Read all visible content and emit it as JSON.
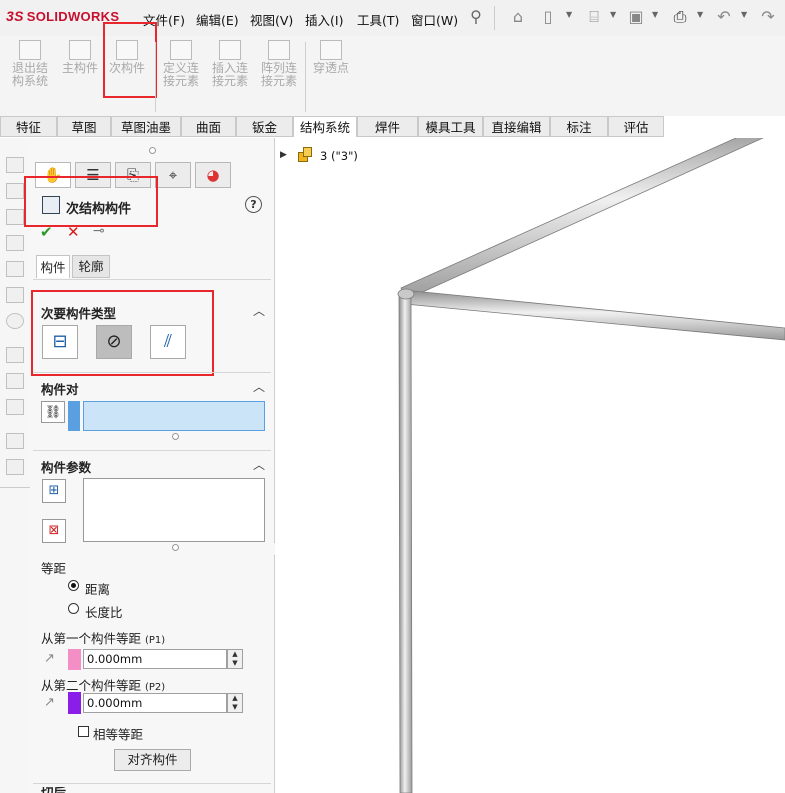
{
  "app": {
    "logo_ds": "3S",
    "logo_text": "SOLIDWORKS"
  },
  "menu": [
    "文件(F)",
    "编辑(E)",
    "视图(V)",
    "插入(I)",
    "工具(T)",
    "窗口(W)"
  ],
  "ribbon": {
    "buttons": [
      {
        "line1": "退出结",
        "line2": "构系统"
      },
      {
        "line1": "主构件",
        "line2": ""
      },
      {
        "line1": "次构件",
        "line2": ""
      },
      {
        "line1": "定义连",
        "line2": "接元素"
      },
      {
        "line1": "插入连",
        "line2": "接元素"
      },
      {
        "line1": "阵列连",
        "line2": "接元素"
      },
      {
        "line1": "穿透点",
        "line2": ""
      }
    ]
  },
  "tabs": [
    "特征",
    "草图",
    "草图油墨",
    "曲面",
    "钣金",
    "结构系统",
    "焊件",
    "模具工具",
    "直接编辑",
    "标注",
    "评估"
  ],
  "tree": {
    "item": "3 (\"3\")"
  },
  "pm": {
    "title": "次结构构件",
    "help": "?",
    "ok": "✔",
    "cancel": "✕",
    "pin": "⊸",
    "subtab_members": "构件",
    "subtab_profile": "轮廓",
    "sec_type": "次要构件类型",
    "sec_pair": "构件对",
    "sec_params": "构件参数",
    "equidistant": "等距",
    "radio_distance": "距离",
    "radio_ratio": "长度比",
    "p1_label": "从第一个构件等距",
    "p1_tag": "(P1)",
    "p1_value": "0.000mm",
    "p2_label": "从第二个构件等距",
    "p2_tag": "(P2)",
    "p2_value": "0.000mm",
    "equal_label": "相等等距",
    "align_button": "对齐构件",
    "bottom_cut": "切后"
  },
  "colors": {
    "brand": "#c8102e",
    "highlight": "#e8262b",
    "p1": "#f48fc6",
    "p2": "#8a1ee8",
    "pair_bar": "#5a9fe0",
    "pair_field": "#cce4f7"
  }
}
